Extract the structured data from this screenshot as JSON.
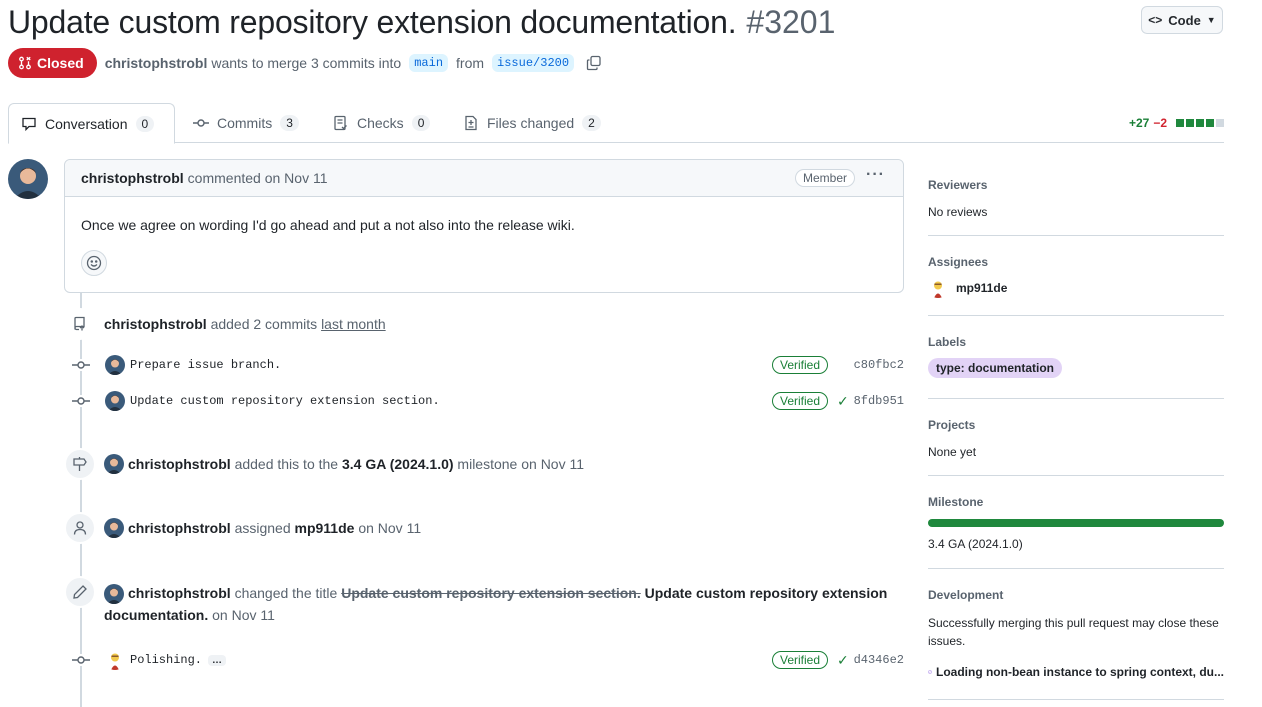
{
  "header": {
    "title": "Update custom repository extension documentation.",
    "number": "#3201",
    "code_button": "Code"
  },
  "meta": {
    "state": "Closed",
    "author": "christophstrobl",
    "text_wants": "wants to merge 3 commits into",
    "base_branch": "main",
    "text_from": "from",
    "head_branch": "issue/3200"
  },
  "tabs": [
    {
      "label": "Conversation",
      "count": "0",
      "icon": "comment-icon"
    },
    {
      "label": "Commits",
      "count": "3",
      "icon": "commit-icon"
    },
    {
      "label": "Checks",
      "count": "0",
      "icon": "checklist-icon"
    },
    {
      "label": "Files changed",
      "count": "2",
      "icon": "file-diff-icon"
    }
  ],
  "diffstat": {
    "additions": "+27",
    "deletions": "−2"
  },
  "comment": {
    "author": "christophstrobl",
    "action": "commented on Nov 11",
    "role": "Member",
    "body": "Once we agree on wording I'd go ahead and put a not also into the release wiki."
  },
  "timeline": {
    "added_commits": {
      "author": "christophstrobl",
      "text": "added 2 commits",
      "when": "last month"
    },
    "commits": [
      {
        "message": "Prepare issue branch.",
        "verified": "Verified",
        "sha": "c80fbc2",
        "check": false
      },
      {
        "message": "Update custom repository extension section.",
        "verified": "Verified",
        "sha": "8fdb951",
        "check": true
      }
    ],
    "milestone_event": {
      "author": "christophstrobl",
      "text1": "added this to the",
      "milestone": "3.4 GA (2024.1.0)",
      "text2": "milestone on Nov 11"
    },
    "assign_event": {
      "author": "christophstrobl",
      "text1": "assigned",
      "assignee": "mp911de",
      "text2": "on Nov 11"
    },
    "rename_event": {
      "author": "christophstrobl",
      "text1": "changed the title",
      "old_title": "Update custom repository extension section.",
      "new_title": "Update custom repository extension documentation.",
      "text2": "on Nov 11"
    },
    "last_commit": {
      "message": "Polishing.",
      "more": "…",
      "verified": "Verified",
      "sha": "d4346e2"
    }
  },
  "sidebar": {
    "reviewers": {
      "heading": "Reviewers",
      "value": "No reviews"
    },
    "assignees": {
      "heading": "Assignees",
      "value": "mp911de"
    },
    "labels": {
      "heading": "Labels",
      "value": "type: documentation"
    },
    "projects": {
      "heading": "Projects",
      "value": "None yet"
    },
    "milestone": {
      "heading": "Milestone",
      "value": "3.4 GA (2024.1.0)",
      "progress_percent": 100
    },
    "development": {
      "heading": "Development",
      "text": "Successfully merging this pull request may close these issues.",
      "issue": "Loading non-bean instance to spring context, du..."
    }
  },
  "colors": {
    "closed": "#cf222e",
    "verified": "#1a7f37",
    "label": "#e2d3f6",
    "progress": "#1f883d"
  }
}
